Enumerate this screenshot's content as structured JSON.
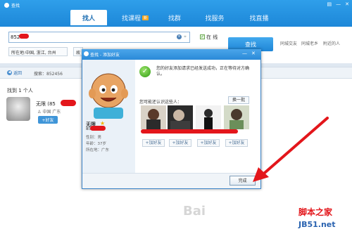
{
  "app": {
    "title": "查找"
  },
  "tabs": [
    {
      "label": "找人",
      "active": true
    },
    {
      "label": "找课程",
      "badge": "新"
    },
    {
      "label": "找群"
    },
    {
      "label": "找服务"
    },
    {
      "label": "找直播"
    }
  ],
  "search": {
    "value": "852",
    "online_label": "在 线",
    "find_button": "查找",
    "filters": [
      "所在地:中国, 浙江, 台州",
      "故"
    ],
    "quick_links": [
      "同城交友",
      "同城老乡",
      "附近的人"
    ]
  },
  "resultbar": {
    "back_label": "返回",
    "search_label": "搜索：852456"
  },
  "results": {
    "count_label": "找到 1 个人",
    "person": {
      "name": "无限",
      "num_prefix": "(85",
      "location": "中国 广东",
      "add_label": "+好友"
    }
  },
  "dialog": {
    "title": "查找 - 添加好友",
    "name": "无限",
    "num_prefix": "85",
    "gender": "性别：男",
    "age": "年龄：37岁",
    "location": "所在地：广东",
    "success_text": "您的好友添加请求已经发送成功，正在等待对方确认。",
    "maybe_know": "您可能还认识这些人：",
    "change_label": "换一批",
    "add_labels": [
      "+加好友",
      "+加好友",
      "+加好友",
      "+加好友"
    ],
    "done_label": "完成"
  },
  "watermark": {
    "line1": "脚本之家",
    "line2": "JB51.net",
    "logo": "Bai"
  }
}
